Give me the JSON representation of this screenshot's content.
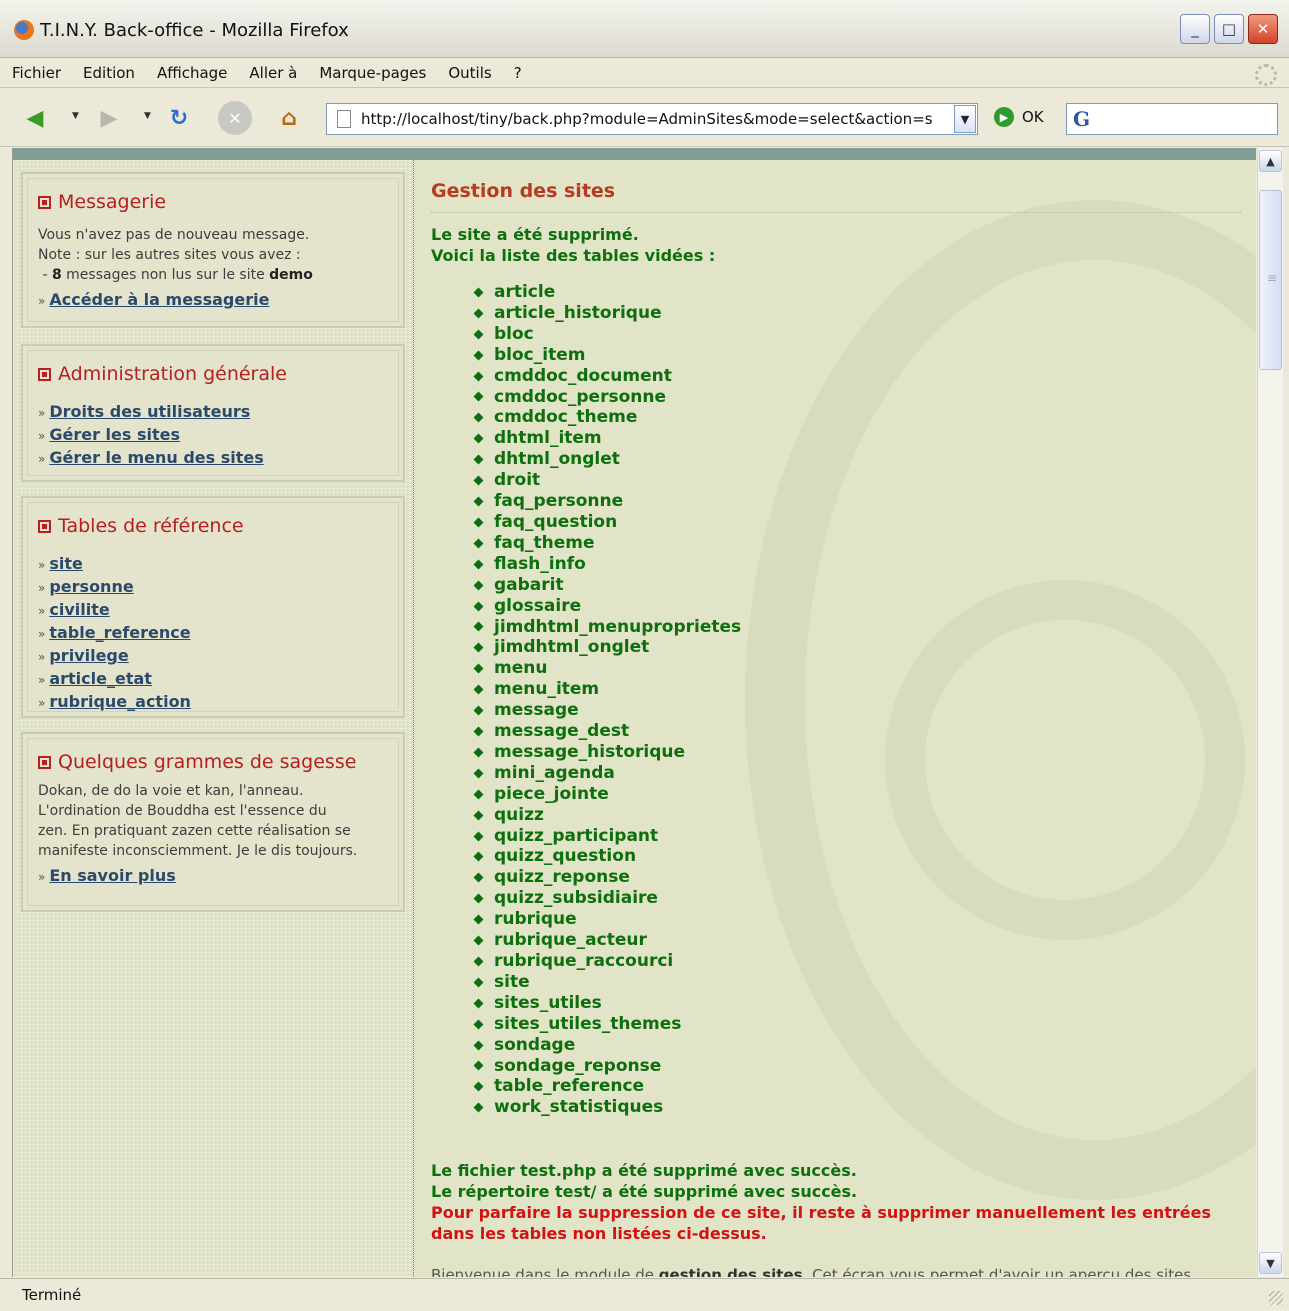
{
  "window": {
    "title": "T.I.N.Y. Back-office - Mozilla Firefox"
  },
  "menu": [
    "Fichier",
    "Edition",
    "Affichage",
    "Aller à",
    "Marque-pages",
    "Outils",
    "?"
  ],
  "nav": {
    "url": "http://localhost/tiny/back.php?module=AdminSites&mode=select&action=s",
    "go_label": "OK",
    "search_placeholder": ""
  },
  "sidebar": {
    "messagerie": {
      "title": "Messagerie",
      "line1": "Vous n'avez pas de nouveau message.",
      "line2": "Note : sur les autres sites vous avez :",
      "line3_prefix": " - ",
      "count": "8",
      "line3_mid": " messages non lus sur le site ",
      "site": "demo",
      "link": "Accéder à la messagerie"
    },
    "admin": {
      "title": "Administration générale",
      "links": [
        "Droits des utilisateurs",
        "Gérer les sites",
        "Gérer le menu des sites"
      ]
    },
    "tables_ref": {
      "title": "Tables de référence",
      "links": [
        "site",
        "personne",
        "civilite",
        "table_reference",
        "privilege",
        "article_etat",
        "rubrique_action"
      ]
    },
    "sagesse": {
      "title": "Quelques grammes de sagesse",
      "lines": [
        "Dokan, de do la voie et kan, l'anneau.",
        "L'ordination de Bouddha est l'essence du",
        "zen. En pratiquant zazen cette réalisation se",
        "manifeste inconsciemment. Je le dis toujours."
      ],
      "link": "En savoir plus"
    }
  },
  "content": {
    "title": "Gestion des sites",
    "msg1": "Le site a été supprimé.",
    "msg2": "Voici la liste des tables vidées :",
    "tables": [
      "article",
      "article_historique",
      "bloc",
      "bloc_item",
      "cmddoc_document",
      "cmddoc_personne",
      "cmddoc_theme",
      "dhtml_item",
      "dhtml_onglet",
      "droit",
      "faq_personne",
      "faq_question",
      "faq_theme",
      "flash_info",
      "gabarit",
      "glossaire",
      "jimdhtml_menuproprietes",
      "jimdhtml_onglet",
      "menu",
      "menu_item",
      "message",
      "message_dest",
      "message_historique",
      "mini_agenda",
      "piece_jointe",
      "quizz",
      "quizz_participant",
      "quizz_question",
      "quizz_reponse",
      "quizz_subsidiaire",
      "rubrique",
      "rubrique_acteur",
      "rubrique_raccourci",
      "site",
      "sites_utiles",
      "sites_utiles_themes",
      "sondage",
      "sondage_reponse",
      "table_reference",
      "work_statistiques"
    ],
    "file_msg": "Le fichier test.php a été supprimé avec succès.",
    "dir_msg": "Le répertoire test/ a été supprimé avec succès.",
    "warn1": "Pour parfaire la suppression de ce site, il reste à supprimer manuellement les entrées",
    "warn2": "dans les tables non listées ci-dessus.",
    "welcome_prefix": "Bienvenue dans le module de ",
    "welcome_bold": "gestion des sites",
    "welcome_suffix": ". Cet écran vous permet d'avoir un aperçu des sites"
  },
  "status": "Terminé"
}
